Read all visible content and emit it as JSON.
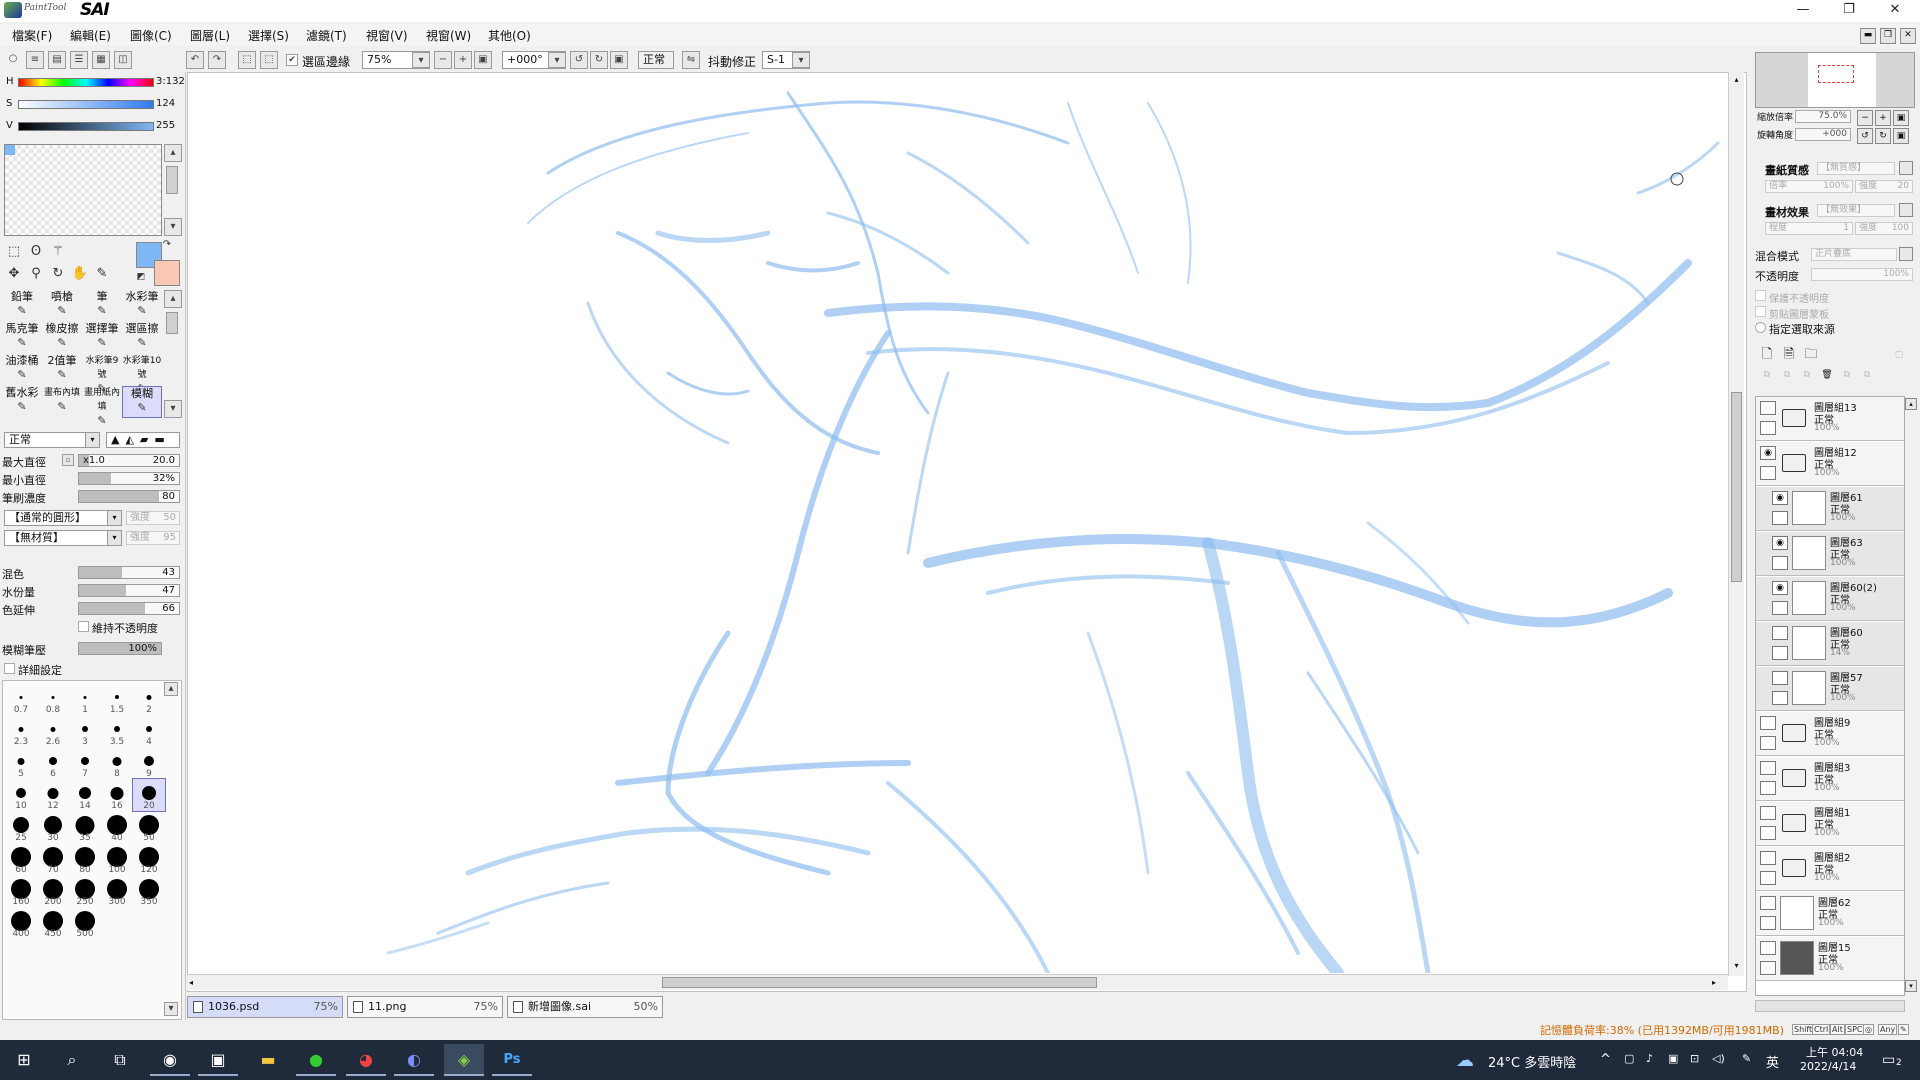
{
  "app": {
    "logo_sub": "PaintTool",
    "logo_main": "SAI",
    "min": "—",
    "restore": "❐",
    "close": "✕"
  },
  "menu": [
    "檔案(F)",
    "編輯(E)",
    "圖像(C)",
    "圖層(L)",
    "選擇(S)",
    "濾鏡(T)",
    "視窗(V)",
    "視窗(W)",
    "其他(O)"
  ],
  "toolbar": {
    "selection_edge_label": "選區邊緣",
    "zoom": "75%",
    "rotation": "+000°",
    "mode": "正常",
    "stabilizer_label": "抖動修正",
    "stabilizer_value": "S-1"
  },
  "color": {
    "h_label": "H",
    "h_value": "3:132",
    "s_label": "S",
    "s_value": "124",
    "v_label": "V",
    "v_value": "255",
    "primary": "#7fb7f5",
    "secondary": "#f8c8b4"
  },
  "tools": [
    {
      "label": "鉛筆",
      "icon": "pencil-icon"
    },
    {
      "label": "噴槍",
      "icon": "airbrush-icon"
    },
    {
      "label": "筆",
      "icon": "pen-icon"
    },
    {
      "label": "水彩筆",
      "icon": "watercolor-icon"
    },
    {
      "label": "馬克筆",
      "icon": "marker-icon"
    },
    {
      "label": "橡皮擦",
      "icon": "eraser-icon"
    },
    {
      "label": "選擇筆",
      "icon": "select-pen-icon"
    },
    {
      "label": "選區擦",
      "icon": "select-eraser-icon"
    },
    {
      "label": "油漆桶",
      "icon": "bucket-icon"
    },
    {
      "label": "2值筆",
      "icon": "binary-pen-icon"
    },
    {
      "label": "水彩筆9號",
      "icon": "watercolor-icon"
    },
    {
      "label": "水彩筆10號",
      "icon": "watercolor-icon"
    },
    {
      "label": "舊水彩",
      "icon": "old-watercolor-icon"
    },
    {
      "label": "畫布內填",
      "icon": "canvas-fill-icon"
    },
    {
      "label": "畫用紙內填",
      "icon": "paper-fill-icon"
    },
    {
      "label": "模糊",
      "icon": "blur-icon"
    }
  ],
  "brush": {
    "mode": "正常",
    "max_size_label": "最大直徑",
    "max_size_mult": "x1.0",
    "max_size_value": "20.0",
    "min_size_label": "最小直徑",
    "min_size_value": "32%",
    "density_label": "筆刷濃度",
    "density_value": "80",
    "shape": "【通常的圓形】",
    "shape_strength_label": "強度",
    "shape_strength": "50",
    "texture": "【無材質】",
    "texture_strength_label": "強度",
    "texture_strength": "95",
    "blending_label": "混色",
    "blending_value": "43",
    "dilution_label": "水份量",
    "dilution_value": "47",
    "persistence_label": "色延伸",
    "persistence_value": "66",
    "keep_opacity_label": "維持不透明度",
    "blur_pressure_label": "模糊筆壓",
    "blur_pressure_value": "100%",
    "detail_label": "詳細設定"
  },
  "brush_sizes": [
    "0.7",
    "0.8",
    "1",
    "1.5",
    "2",
    "2.3",
    "2.6",
    "3",
    "3.5",
    "4",
    "5",
    "6",
    "7",
    "8",
    "9",
    "10",
    "12",
    "14",
    "16",
    "20",
    "25",
    "30",
    "35",
    "40",
    "50",
    "60",
    "70",
    "80",
    "100",
    "120",
    "160",
    "200",
    "250",
    "300",
    "350",
    "400",
    "450",
    "500"
  ],
  "tabs": [
    {
      "name": "1036.psd",
      "zoom": "75%"
    },
    {
      "name": "11.png",
      "zoom": "75%"
    },
    {
      "name": "新增圖像.sai",
      "zoom": "50%"
    }
  ],
  "right": {
    "zoom_label": "縮放倍率",
    "zoom_value": "75.0%",
    "angle_label": "旋轉角度",
    "angle_value": "+000",
    "paper_texture_label": "畫紙質感",
    "paper_texture_value": "【無質感】",
    "paper_scale_label": "倍率",
    "paper_scale_value": "100%",
    "paper_strength_label": "強度",
    "paper_strength_value": "20",
    "paper_effect_label": "畫材效果",
    "paper_effect_value": "【無效果】",
    "effect_level_label": "程度",
    "effect_level_value": "1",
    "effect_strength_label": "強度",
    "effect_strength_value": "100",
    "blend_label": "混合模式",
    "blend_value": "正片疊底",
    "opacity_label": "不透明度",
    "opacity_value": "100%",
    "preserve_opacity_label": "保護不透明度",
    "clip_label": "剪貼圖層蒙板",
    "selection_source_label": "指定選取來源"
  },
  "layers": [
    {
      "name": "圖層組13",
      "mode": "正常",
      "opacity": "100%",
      "type": "folder",
      "visible": false,
      "sub": false
    },
    {
      "name": "圖層組12",
      "mode": "正常",
      "opacity": "100%",
      "type": "folder",
      "visible": true,
      "sub": false
    },
    {
      "name": "圖層61",
      "mode": "正常",
      "opacity": "100%",
      "type": "layer",
      "visible": true,
      "sub": true
    },
    {
      "name": "圖層63",
      "mode": "正常",
      "opacity": "100%",
      "type": "layer",
      "visible": true,
      "sub": true
    },
    {
      "name": "圖層60(2)",
      "mode": "正常",
      "opacity": "100%",
      "type": "layer",
      "visible": true,
      "sub": true
    },
    {
      "name": "圖層60",
      "mode": "正常",
      "opacity": "14%",
      "type": "layer",
      "visible": false,
      "sub": true
    },
    {
      "name": "圖層57",
      "mode": "正常",
      "opacity": "100%",
      "type": "layer",
      "visible": false,
      "sub": true
    },
    {
      "name": "圖層組9",
      "mode": "正常",
      "opacity": "100%",
      "type": "folder",
      "visible": false,
      "sub": false
    },
    {
      "name": "圖層組3",
      "mode": "正常",
      "opacity": "100%",
      "type": "folder",
      "visible": false,
      "sub": false
    },
    {
      "name": "圖層組1",
      "mode": "正常",
      "opacity": "100%",
      "type": "folder",
      "visible": false,
      "sub": false
    },
    {
      "name": "圖層組2",
      "mode": "正常",
      "opacity": "100%",
      "type": "folder",
      "visible": false,
      "sub": false
    },
    {
      "name": "圖層62",
      "mode": "正常",
      "opacity": "100%",
      "type": "layer",
      "visible": false,
      "sub": false
    },
    {
      "name": "圖層15",
      "mode": "正常",
      "opacity": "100%",
      "type": "layer-dark",
      "visible": false,
      "sub": false
    }
  ],
  "status": {
    "memory": "記憶體負荷率:38% (已用1392MB/可用1981MB)",
    "mod_keys": [
      "Shift",
      "Ctrl",
      "Alt",
      "SPC",
      "◎",
      "Any",
      "✎"
    ]
  },
  "taskbar": {
    "apps": [
      "windows-logo-icon",
      "search-icon",
      "task-view-icon",
      "app-icon",
      "capture-icon",
      "folder-icon",
      "line-icon",
      "chrome-icon",
      "discord-icon",
      "sai-icon",
      "photoshop-icon"
    ],
    "weather": "24°C  多雲時陰",
    "ime": "英",
    "time": "上午 04:04",
    "date": "2022/4/14",
    "notifications": "2"
  }
}
